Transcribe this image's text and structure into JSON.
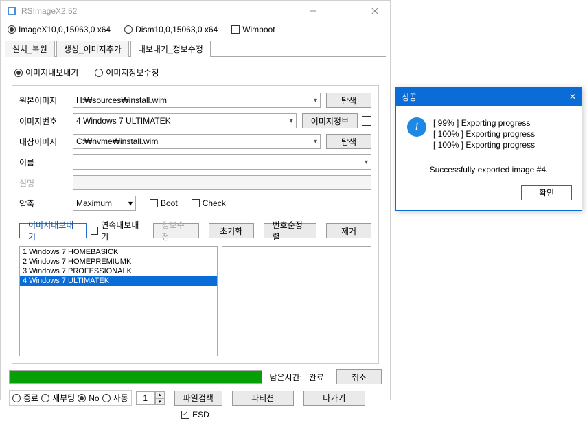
{
  "window": {
    "title": "RSImageX2.52",
    "top_options": {
      "imagex": "ImageX10,0,15063,0 x64",
      "dism": "Dism10,0,15063,0 x64",
      "wimboot": "Wimboot"
    },
    "tabs": {
      "install": "설치_복원",
      "create": "생성_이미지추가",
      "export": "내보내기_정보수정"
    },
    "sub_options": {
      "export_image": "이미지내보내기",
      "edit_info": "이미지정보수정"
    },
    "form": {
      "source_label": "원본이미지",
      "source_value": "H:₩sources₩install.wim",
      "browse": "탐색",
      "index_label": "이미지번호",
      "index_value": "4  Windows 7 ULTIMATEK",
      "image_info": "이미지정보",
      "target_label": "대상이미지",
      "target_value": "C:₩nvme₩install.wim",
      "name_label": "이름",
      "name_value": "",
      "desc_label": "설명",
      "compress_label": "압축",
      "compress_value": "Maximum",
      "boot": "Boot",
      "check": "Check"
    },
    "actions": {
      "export": "이미지내보내기",
      "continuous": "연속내보내기",
      "edit_info": "정보수정",
      "reset": "초기화",
      "sort": "번호순정렬",
      "remove": "제거"
    },
    "list": {
      "items": [
        "1  Windows 7 HOMEBASICK",
        "2  Windows 7 HOMEPREMIUMK",
        "3  Windows 7 PROFESSIONALK",
        "4  Windows 7 ULTIMATEK"
      ],
      "selected_index": 3
    },
    "progress": {
      "remain_label": "남은시간:",
      "remain_value": "완료",
      "cancel": "취소"
    },
    "bottom": {
      "shutdown": "종료",
      "reboot": "재부팅",
      "no": "No",
      "auto": "자동",
      "spin_value": "1",
      "file_search": "파일검색",
      "partition": "파티션",
      "exit": "나가기",
      "esd": "ESD"
    }
  },
  "dialog": {
    "title": "성공",
    "lines": [
      "[  99% ] Exporting progress",
      "[ 100% ] Exporting progress",
      "[ 100% ] Exporting progress"
    ],
    "success": "Successfully exported image #4.",
    "ok": "확인"
  }
}
